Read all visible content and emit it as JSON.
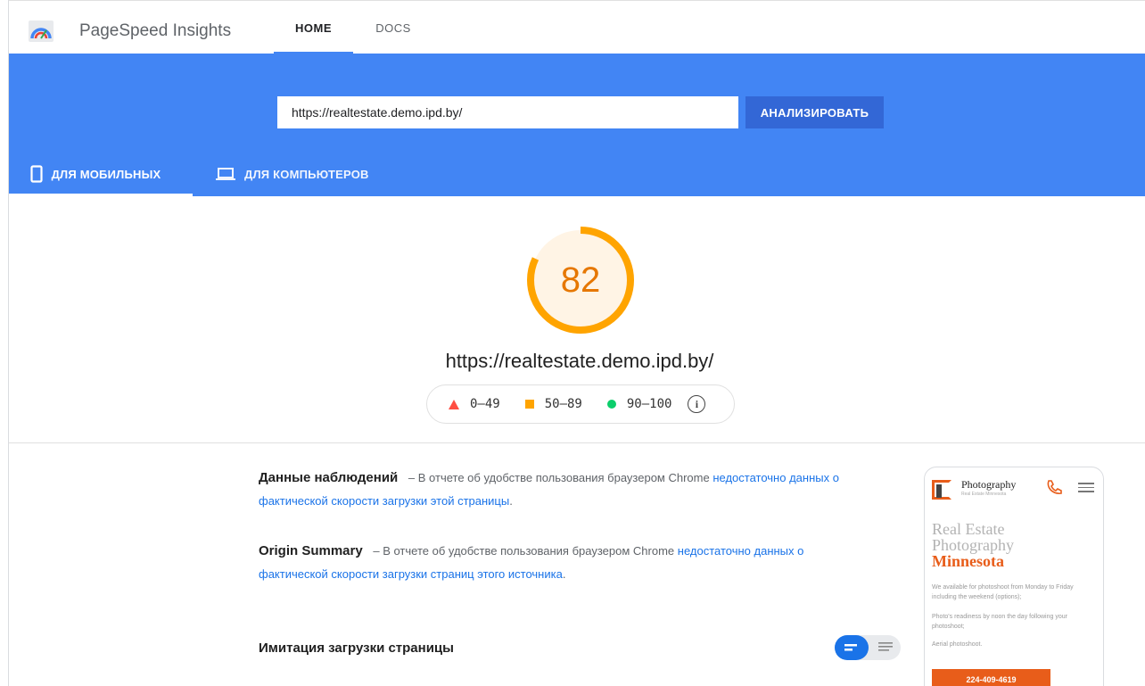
{
  "appbar": {
    "brand": "PageSpeed Insights",
    "nav": [
      {
        "label": "HOME",
        "active": true
      },
      {
        "label": "DOCS",
        "active": false
      }
    ]
  },
  "search": {
    "value": "https://realtestate.demo.ipd.by/",
    "button_label": "АНАЛИЗИРОВАТЬ"
  },
  "device_tabs": {
    "mobile": "ДЛЯ МОБИЛЬНЫХ",
    "desktop": "ДЛЯ КОМПЬЮТЕРОВ",
    "active": "mobile"
  },
  "score": {
    "value": "82",
    "fraction": 0.82,
    "color": "#ffa400",
    "url": "https://realtestate.demo.ipd.by/"
  },
  "legend": {
    "poor": "0–49",
    "average": "50–89",
    "good": "90–100"
  },
  "field_data": {
    "title": "Данные наблюдений",
    "dash": "–",
    "text": "В отчете об удобстве пользования браузером Chrome",
    "link": "недостаточно данных о фактической скорости загрузки этой страницы",
    "end": "."
  },
  "origin_summary": {
    "title": "Origin Summary",
    "dash": "–",
    "text": "В отчете об удобстве пользования браузером Chrome",
    "link": "недостаточно данных о фактической скорости загрузки страниц этого источника",
    "end": "."
  },
  "lab": {
    "title": "Имитация загрузки страницы"
  },
  "preview": {
    "brand": "Photography",
    "subbrand": "Real Estate Minnesota",
    "heading_line1": "Real Estate",
    "heading_line2": "Photography",
    "heading_accent": "Minnesota",
    "para1": "We available for photoshoot from Monday to Friday including the weekend (options);",
    "para2": "Photo's readiness by noon the day following your photoshoot;",
    "para3": "Aerial photoshoot.",
    "cta": "224-409-4619"
  },
  "colors": {
    "brand_blue": "#4285f4",
    "button_blue": "#3367d6",
    "link_blue": "#1a73e8",
    "score_orange": "#ffa400",
    "accent_orange": "#e85d1a"
  }
}
